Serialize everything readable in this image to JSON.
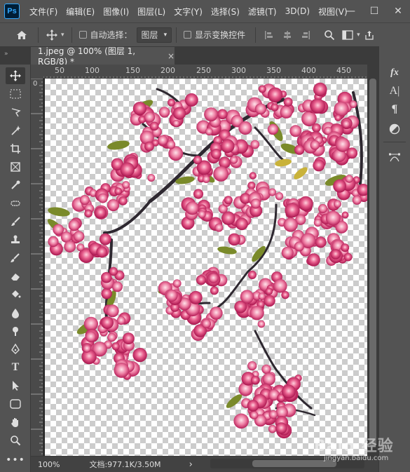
{
  "app": {
    "logo": "Ps"
  },
  "menu": [
    "文件(F)",
    "编辑(E)",
    "图像(I)",
    "图层(L)",
    "文字(Y)",
    "选择(S)",
    "滤镜(T)",
    "3D(D)",
    "视图(V)"
  ],
  "window_controls": {
    "minimize": "—",
    "maximize": "☐",
    "close": "✕"
  },
  "options": {
    "auto_select_label": "自动选择：",
    "auto_select_checked": false,
    "layer_dropdown": "图层",
    "show_transform_label": "显示变换控件",
    "show_transform_checked": false
  },
  "document_tab": {
    "title": "1.jpeg @ 100% (图层 1, RGB/8) *",
    "close": "×"
  },
  "ruler": {
    "top_ticks": [
      "50",
      "100",
      "150",
      "200",
      "250",
      "300",
      "350",
      "400",
      "450"
    ],
    "left_ticks": [
      "0"
    ]
  },
  "status": {
    "zoom": "100%",
    "doc_info": "文档:977.1K/3.50M",
    "arrow": "›"
  },
  "watermark": {
    "text": "Baid 经验",
    "url": "jingyan.baidu.com"
  },
  "colors": {
    "bg": "#535353",
    "accent": "#31a8ff"
  }
}
